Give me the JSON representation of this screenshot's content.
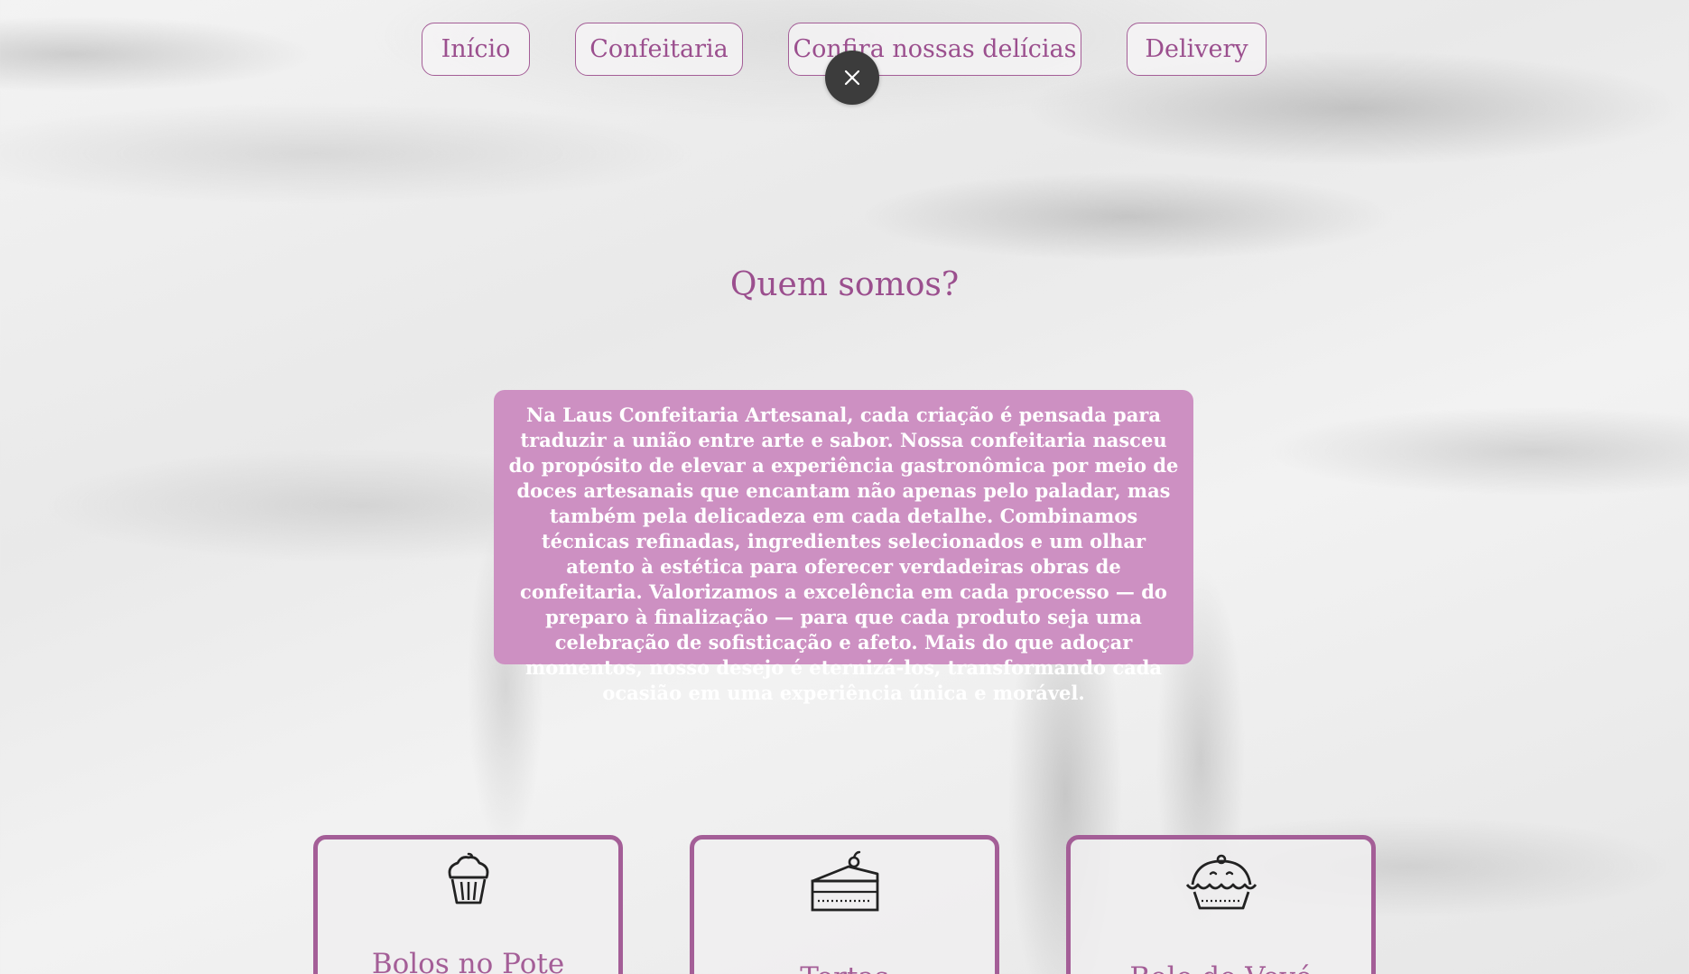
{
  "nav": {
    "items": [
      {
        "label": "Início"
      },
      {
        "label": "Confeitaria"
      },
      {
        "label": "Confira nossas delícias"
      },
      {
        "label": "Delivery"
      }
    ]
  },
  "overlay": {
    "close_icon": "close-icon"
  },
  "about": {
    "title": "Quem somos?",
    "text": "Na Laus Confeitaria Artesanal, cada criação é pensada para traduzir a união entre arte e sabor. Nossa confeitaria nasceu do propósito de elevar a experiência gastronômica por meio de doces artesanais que encantam não apenas pelo paladar, mas também pela delicadeza em cada detalhe. Combinamos técnicas refinadas, ingredientes selecionados e um olhar atento à estética para oferecer verdadeiras obras de confeitaria. Valorizamos a excelência em cada processo — do preparo à finalização — para que cada produto seja uma celebração de sofisticação e afeto. Mais do que adoçar momentos, nosso desejo é eternizá-los, transformando cada ocasião em uma experiência única e morável."
  },
  "cards": [
    {
      "title": "Bolos no Pote",
      "icon": "cupcake-icon"
    },
    {
      "title": "Tortas",
      "icon": "cake-slice-icon"
    },
    {
      "title": "Bolo de Vovó",
      "icon": "pie-icon"
    }
  ],
  "colors": {
    "accent": "#9b4f8e",
    "card_border": "#a45e97",
    "about_bg": "#cd90c2",
    "close_bg": "#3c3c3c"
  }
}
